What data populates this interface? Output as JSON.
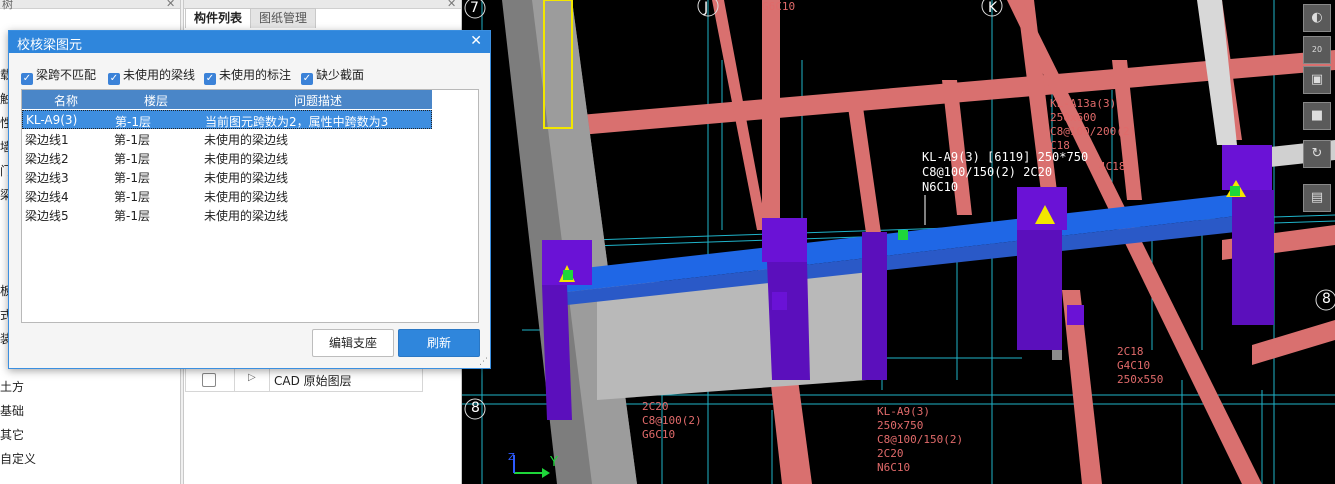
{
  "left_panel": {
    "header": "树",
    "items": [
      "载",
      "触",
      "性",
      "墙",
      "门窗",
      "梁",
      "板",
      "式楼",
      "装修",
      "土方",
      "基础",
      "其它",
      "自定义"
    ]
  },
  "mid_panel": {
    "tabs": [
      "构件列表",
      "图纸管理"
    ],
    "layer_row_label": "CAD 原始图层"
  },
  "dialog": {
    "title": "校核梁图元",
    "filters": [
      "梁跨不匹配",
      "未使用的梁线",
      "未使用的标注",
      "缺少截面"
    ],
    "columns": [
      "名称",
      "楼层",
      "问题描述"
    ],
    "rows": [
      {
        "name": "KL-A9(3)",
        "floor": "第-1层",
        "desc": "当前图元跨数为2，属性中跨数为3",
        "selected": true
      },
      {
        "name": "梁边线1",
        "floor": "第-1层",
        "desc": "未使用的梁边线",
        "selected": false
      },
      {
        "name": "梁边线2",
        "floor": "第-1层",
        "desc": "未使用的梁边线",
        "selected": false
      },
      {
        "name": "梁边线3",
        "floor": "第-1层",
        "desc": "未使用的梁边线",
        "selected": false
      },
      {
        "name": "梁边线4",
        "floor": "第-1层",
        "desc": "未使用的梁边线",
        "selected": false
      },
      {
        "name": "梁边线5",
        "floor": "第-1层",
        "desc": "未使用的梁边线",
        "selected": false
      }
    ],
    "buttons": {
      "edit": "编辑支座",
      "refresh": "刷新"
    }
  },
  "viewport": {
    "axis_labels": [
      "7",
      "J",
      "K",
      "8",
      "8"
    ],
    "annotations": [
      "KL-A9(3) [6119] 250*750",
      "C8@100/150(2) 2C20",
      "N6C10",
      "2C20",
      "C8@100(2)",
      "G6C10",
      "KL-A9(3)",
      "250x750",
      "C8@100/150(2)",
      "2C20",
      "N6C10",
      "2C18",
      "G4C10",
      "250x550",
      "G6C10",
      "4C18",
      "KL-A13a(3)",
      "250x600",
      "C8@100/200(2)",
      "C18"
    ],
    "axes": {
      "y": "Y",
      "z": "Z"
    }
  },
  "toolbar": {
    "zoom_label": "20"
  },
  "colors": {
    "accent": "#2f86dc",
    "beam_pink": "#d9706f",
    "beam_blue": "#1f67e6",
    "column_purple": "#6a12d6",
    "grid_cyan": "#1fb3c9",
    "column_gray": "#8c8c8c"
  }
}
